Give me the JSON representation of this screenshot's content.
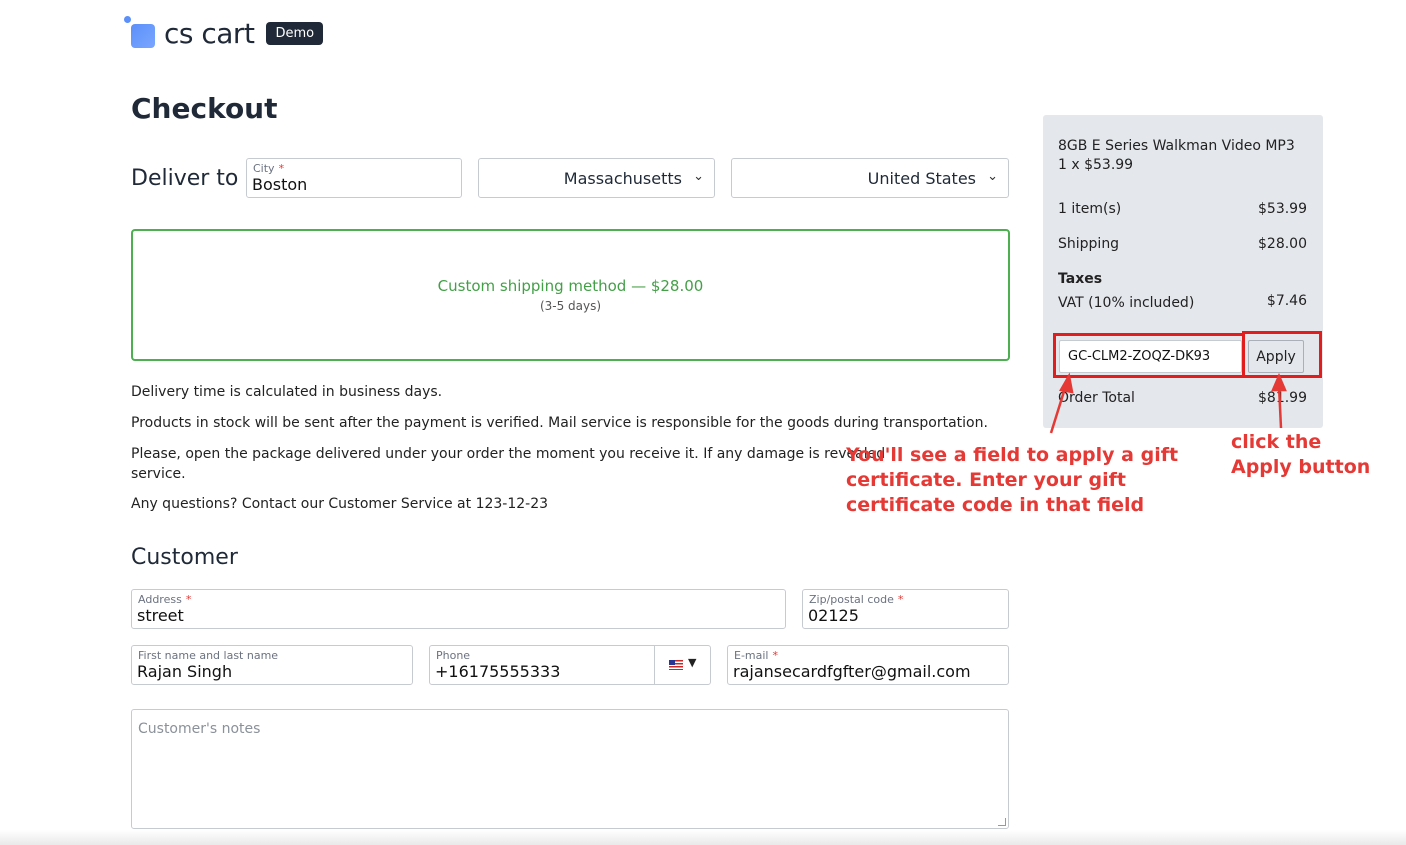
{
  "brand": {
    "logo_text": "cs cart",
    "badge": "Demo",
    "accent_color": "#5b8ff9"
  },
  "page": {
    "title": "Checkout"
  },
  "delivery": {
    "label": "Deliver to",
    "city_label": "City",
    "city_value": "Boston",
    "state_value": "Massachusetts",
    "country_value": "United States"
  },
  "shipping": {
    "method": "Custom shipping method — $28.00",
    "days": "(3-5 days)",
    "selected_color": "#4caf50"
  },
  "info": {
    "p1": "Delivery time is calculated in business days.",
    "p2": "Products in stock will be sent after the payment is verified. Mail service is responsible for the goods during transportation.",
    "p3_line1": "Please, open the package delivered under your order the moment you receive it. If any damage is revealed",
    "p3_line2": "service.",
    "p4": "Any questions? Contact our Customer Service at 123-12-23"
  },
  "customer": {
    "title": "Customer",
    "address_label": "Address",
    "address_value": "street",
    "zip_label": "Zip/postal code",
    "zip_value": "02125",
    "name_label": "First name and last name",
    "name_value": "Rajan Singh",
    "phone_label": "Phone",
    "phone_value": "+16175555333",
    "email_label": "E-mail",
    "email_value": "rajansecardfgfter@gmail.com",
    "notes_placeholder": "Customer's notes",
    "required_mark": "*",
    "flag_icon": "us-flag-icon"
  },
  "summary": {
    "product_name": "8GB E Series Walkman Video MP3",
    "product_qty": "1 x $53.99",
    "items_label": "1 item(s)",
    "items_value": "$53.99",
    "shipping_label": "Shipping",
    "shipping_value": "$28.00",
    "taxes_label": "Taxes",
    "vat_label": "VAT (10% included)",
    "vat_value": "$7.46",
    "gift_code": "GC-CLM2-ZOQZ-DK93",
    "apply_label": "Apply",
    "total_label": "Order Total",
    "total_value": "$81.99"
  },
  "annotations": {
    "gift_note_l1": "You'll see a field to apply a gift",
    "gift_note_l2": "certificate. Enter your gift",
    "gift_note_l3": "certificate code in that field",
    "apply_note_l1": "click the",
    "apply_note_l2": "Apply button",
    "highlight_color": "#e11d1d"
  }
}
